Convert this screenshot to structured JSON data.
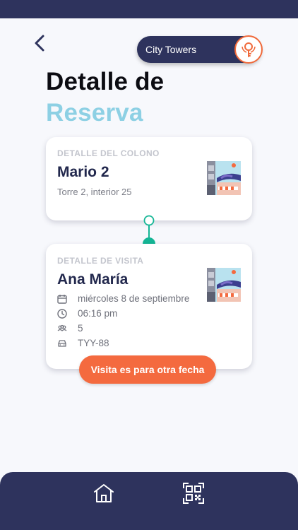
{
  "header": {
    "brand_name": "City Towers",
    "back_icon": "chevron-left-icon",
    "brand_logo_icon": "key-logo-icon"
  },
  "title": {
    "line1": "Detalle de",
    "line2": "Reserva"
  },
  "colono_card": {
    "label": "DETALLE DEL COLONO",
    "name": "Mario 2",
    "address": "Torre 2, interior 25"
  },
  "visita_card": {
    "label": "DETALLE DE VISITA",
    "name": "Ana María",
    "date": "miércoles 8 de septiembre",
    "time": "06:16 pm",
    "guests": "5",
    "plate": "TYY-88",
    "icons": [
      "calendar-icon",
      "clock-icon",
      "people-icon",
      "car-icon"
    ]
  },
  "cta": {
    "label": "Visita es para otra fecha"
  },
  "bottom_nav": {
    "items": [
      "home-icon",
      "qr-code-icon"
    ]
  },
  "colors": {
    "navy": "#2e335d",
    "accent_orange": "#f46a3f",
    "title_light_blue": "#8dd0e4",
    "teal": "#14b595"
  }
}
